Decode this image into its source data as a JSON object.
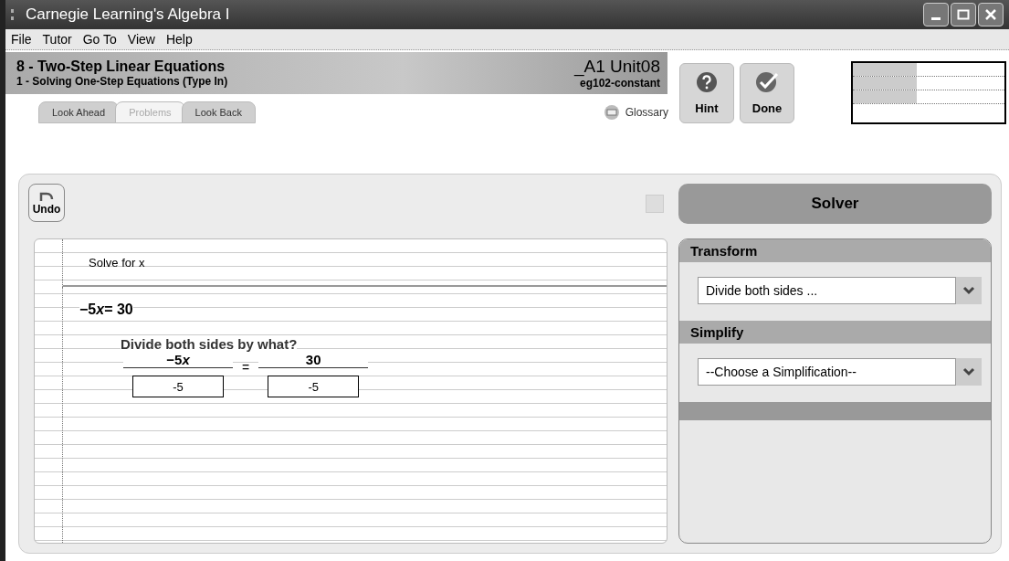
{
  "window": {
    "title": "Carnegie Learning's Algebra I"
  },
  "menu": [
    "File",
    "Tutor",
    "Go To",
    "View",
    "Help"
  ],
  "header": {
    "unit": "8 - Two-Step Linear Equations",
    "section": "1 - Solving One-Step Equations (Type In)",
    "code": "_A1 Unit08",
    "problem": "eg102-constant"
  },
  "tabs": [
    {
      "label": "Look Ahead",
      "selected": false
    },
    {
      "label": "Problems",
      "selected": true
    },
    {
      "label": "Look Back",
      "selected": false
    }
  ],
  "glossary": "Glossary",
  "buttons": {
    "hint": "Hint",
    "done": "Done",
    "undo": "Undo"
  },
  "skills": [
    {
      "level": 0.42
    },
    {
      "level": 0.42
    },
    {
      "level": 0.42
    }
  ],
  "worksheet": {
    "prompt": "Solve for x",
    "equation": {
      "coefficient": "−5",
      "variable": "x",
      "rest": "= 30"
    },
    "question": "Divide both sides by what?",
    "left_numerator": {
      "coefficient": "−5",
      "variable": "x"
    },
    "right_numerator": "30",
    "equals": "=",
    "left_value": "-5",
    "right_value": "-5"
  },
  "solver": {
    "title": "Solver",
    "sections": [
      {
        "heading": "Transform",
        "value": "Divide both sides ..."
      },
      {
        "heading": "Simplify",
        "value": "--Choose a Simplification--"
      }
    ]
  }
}
